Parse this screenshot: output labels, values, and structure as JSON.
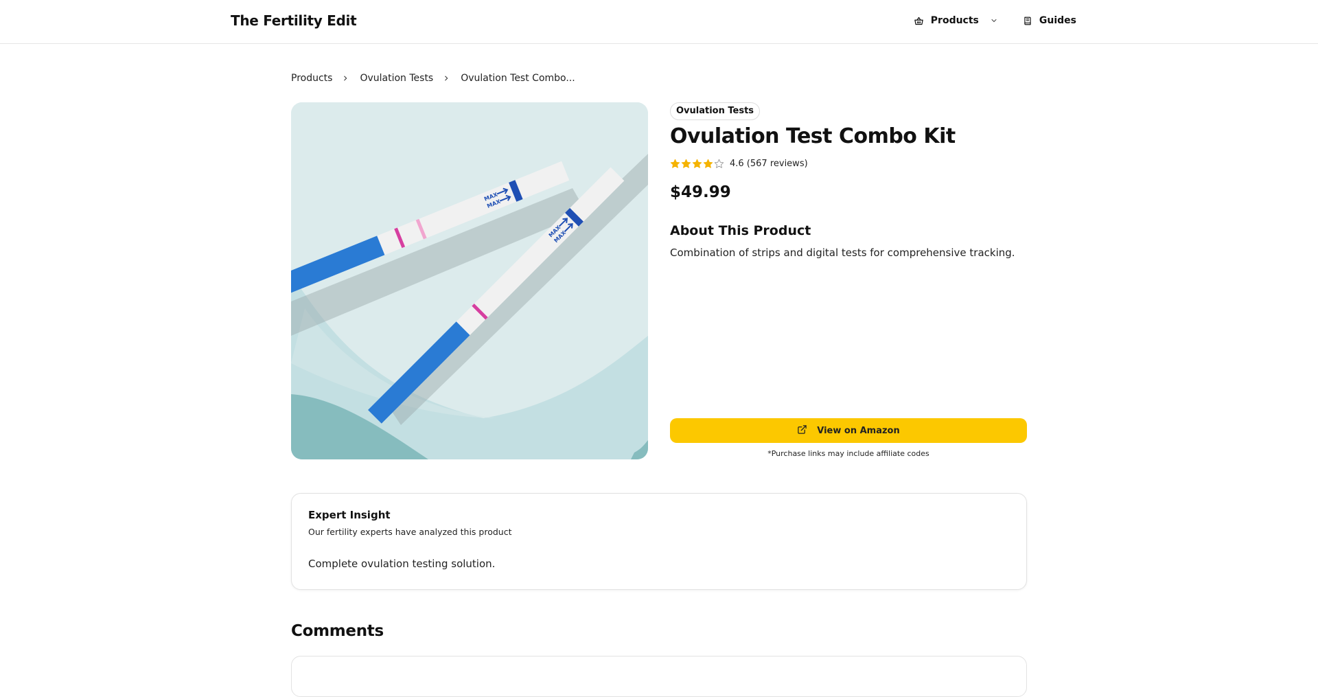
{
  "header": {
    "brand": "The Fertility Edit",
    "nav": {
      "products_label": "Products",
      "guides_label": "Guides"
    }
  },
  "breadcrumb": [
    "Products",
    "Ovulation Tests",
    "Ovulation Test Combo..."
  ],
  "product": {
    "category": "Ovulation Tests",
    "title": "Ovulation Test Combo Kit",
    "rating": 4.6,
    "rating_text": "4.6 (567 reviews)",
    "price": "$49.99",
    "about_heading": "About This Product",
    "about_text": "Combination of strips and digital tests for comprehensive tracking.",
    "buy_label": "View on Amazon",
    "affiliate_note": "*Purchase links may include affiliate codes",
    "image_strip_label": "MAX"
  },
  "insight": {
    "heading": "Expert Insight",
    "subheading": "Our fertility experts have analyzed this product",
    "body": "Complete ovulation testing solution."
  },
  "comments": {
    "heading": "Comments"
  },
  "colors": {
    "accent_button": "#fcc800",
    "star": "#f5b301",
    "strip_blue": "#2a7bd4",
    "test_line": "#d63fa0"
  },
  "icons": {
    "products": "basket-icon",
    "chevron": "chevron-down-icon",
    "guides": "book-icon",
    "breadcrumb_sep": "chevron-right-icon",
    "external": "external-link-icon",
    "star": "star-icon"
  }
}
